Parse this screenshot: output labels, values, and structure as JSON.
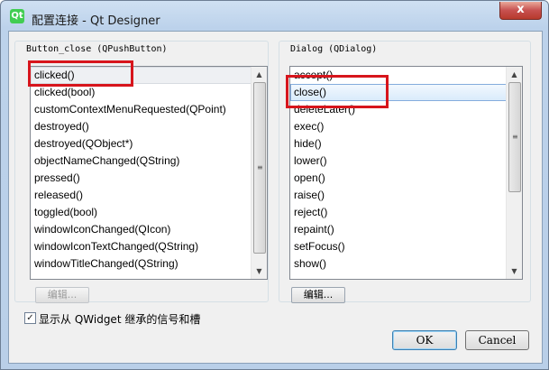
{
  "window": {
    "title": "配置连接 - Qt Designer",
    "app_icon": "Qt",
    "close_glyph": "x"
  },
  "left_panel": {
    "title": "Button_close (QPushButton)",
    "items": [
      "clicked()",
      "clicked(bool)",
      "customContextMenuRequested(QPoint)",
      "destroyed()",
      "destroyed(QObject*)",
      "objectNameChanged(QString)",
      "pressed()",
      "released()",
      "toggled(bool)",
      "windowIconChanged(QIcon)",
      "windowIconTextChanged(QString)",
      "windowTitleChanged(QString)"
    ],
    "edit_label": "编辑...",
    "highlighted_item": "clicked()"
  },
  "right_panel": {
    "title": "Dialog (QDialog)",
    "items": [
      "accept()",
      "close()",
      "deleteLater()",
      "exec()",
      "hide()",
      "lower()",
      "open()",
      "raise()",
      "reject()",
      "repaint()",
      "setFocus()",
      "show()"
    ],
    "edit_label": "编辑...",
    "selected_item": "close()"
  },
  "options": {
    "show_inherited_label": "显示从 QWidget 继承的信号和槽",
    "show_inherited_checked": true
  },
  "buttons": {
    "ok": "OK",
    "cancel": "Cancel"
  },
  "colors": {
    "annotation_red": "#d7151c",
    "selection_border": "#84acdd"
  }
}
